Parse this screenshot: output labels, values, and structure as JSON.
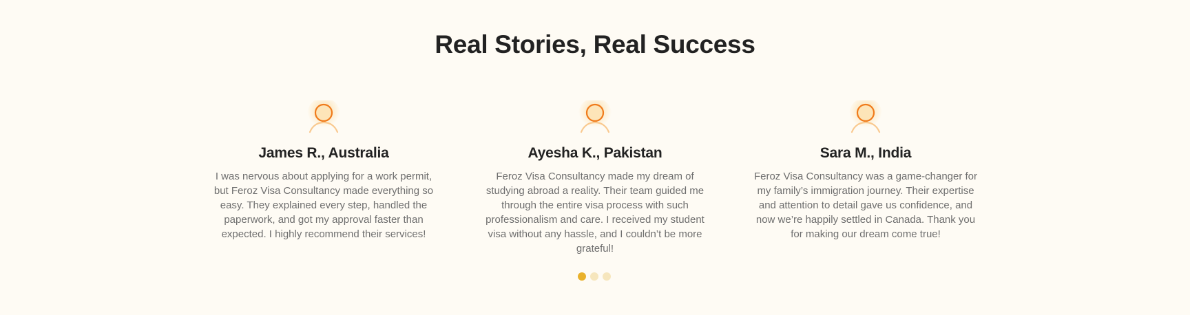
{
  "section": {
    "title": "Real Stories, Real Success"
  },
  "testimonials": [
    {
      "name": "James R., Australia",
      "quote": "I was nervous about applying for a work permit, but Feroz Visa Consultancy made everything so easy. They explained every step, handled the paperwork, and got my approval faster than expected. I highly recommend their services!",
      "icon": "user-icon"
    },
    {
      "name": "Ayesha K., Pakistan",
      "quote": "Feroz Visa Consultancy made my dream of studying abroad a reality. Their team guided me through the entire visa process with such professionalism and care. I received my student visa without any hassle, and I couldn’t be more grateful!",
      "icon": "user-icon"
    },
    {
      "name": "Sara M., India",
      "quote": "Feroz Visa Consultancy was a game-changer for my family’s immigration journey. Their expertise and attention to detail gave us confidence, and now we’re happily settled in Canada. Thank you for making our dream come true!",
      "icon": "user-icon"
    }
  ],
  "pagination": {
    "count": 3,
    "active_index": 0
  },
  "colors": {
    "background": "#fefbf4",
    "accent": "#e9b12b",
    "accent_light": "#f6e6bd",
    "avatar_stroke": "#f07a1a",
    "avatar_fill": "#fde5b8",
    "heading": "#222222",
    "body_text": "#6e6e6e"
  }
}
